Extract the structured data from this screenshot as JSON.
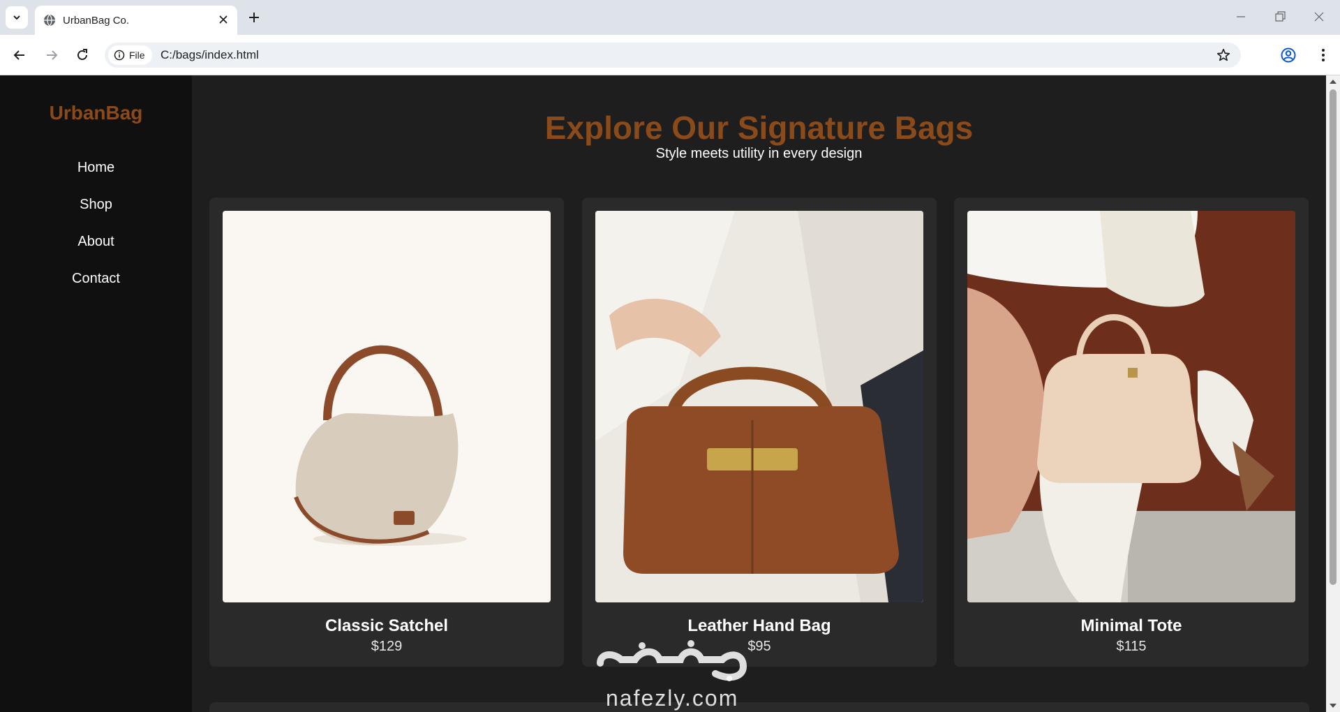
{
  "browser": {
    "tab_title": "UrbanBag Co.",
    "site_info_label": "File",
    "url": "C:/bags/index.html"
  },
  "sidebar": {
    "logo": "UrbanBag",
    "items": [
      {
        "label": "Home"
      },
      {
        "label": "Shop"
      },
      {
        "label": "About"
      },
      {
        "label": "Contact"
      }
    ]
  },
  "hero": {
    "title": "Explore Our Signature Bags",
    "subtitle": "Style meets utility in every design"
  },
  "products": [
    {
      "name": "Classic Satchel",
      "price": "$129"
    },
    {
      "name": "Leather Hand Bag",
      "price": "$95"
    },
    {
      "name": "Minimal Tote",
      "price": "$115"
    }
  ],
  "watermark": {
    "logo_text": "نفذلي",
    "domain": "nafezly.com"
  },
  "colors": {
    "accent_brown": "#8b4a1a",
    "sidebar_bg": "#101010",
    "page_bg": "#1e1e1e",
    "card_bg": "#2a2a2a"
  }
}
